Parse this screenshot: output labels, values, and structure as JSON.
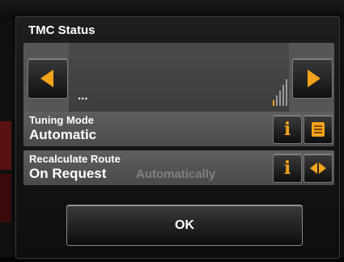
{
  "dialog": {
    "title": "TMC Status"
  },
  "status": {
    "text": "...",
    "prev_icon": "arrow-left-icon",
    "next_icon": "arrow-right-icon",
    "signal_icon": "signal-strength-icon"
  },
  "tuning": {
    "label": "Tuning Mode",
    "value": "Automatic",
    "info_icon": "info-icon",
    "list_icon": "list-icon"
  },
  "recalc": {
    "label": "Recalculate Route",
    "value": "On Request",
    "alternate": "Automatically",
    "info_icon": "info-icon",
    "toggle_icon": "toggle-arrows-icon"
  },
  "ok_label": "OK",
  "colors": {
    "accent": "#f4a31c",
    "row_bg": "#565656",
    "dialog_bg": "#1a1a1a"
  }
}
